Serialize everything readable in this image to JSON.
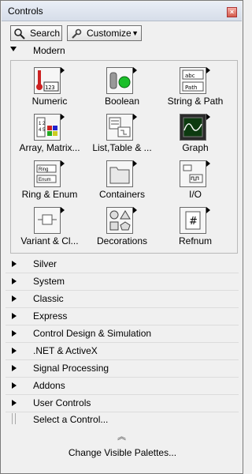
{
  "window": {
    "title": "Controls",
    "close_icon": "close-icon"
  },
  "toolbar": {
    "search_label": "Search",
    "customize_label": "Customize"
  },
  "modern": {
    "label": "Modern",
    "items": [
      {
        "label": "Numeric",
        "icon": "numeric-icon"
      },
      {
        "label": "Boolean",
        "icon": "boolean-icon"
      },
      {
        "label": "String & Path",
        "icon": "string-path-icon"
      },
      {
        "label": "Array, Matrix...",
        "icon": "array-matrix-icon"
      },
      {
        "label": "List,Table & ...",
        "icon": "list-table-icon"
      },
      {
        "label": "Graph",
        "icon": "graph-icon"
      },
      {
        "label": "Ring & Enum",
        "icon": "ring-enum-icon"
      },
      {
        "label": "Containers",
        "icon": "containers-icon"
      },
      {
        "label": "I/O",
        "icon": "io-icon"
      },
      {
        "label": "Variant & Cl...",
        "icon": "variant-class-icon"
      },
      {
        "label": "Decorations",
        "icon": "decorations-icon"
      },
      {
        "label": "Refnum",
        "icon": "refnum-icon"
      }
    ]
  },
  "palettes": [
    {
      "label": "Silver"
    },
    {
      "label": "System"
    },
    {
      "label": "Classic"
    },
    {
      "label": "Express"
    },
    {
      "label": "Control Design & Simulation"
    },
    {
      "label": ".NET & ActiveX"
    },
    {
      "label": "Signal Processing"
    },
    {
      "label": "Addons"
    },
    {
      "label": "User Controls"
    }
  ],
  "select_control": "Select a Control...",
  "change_palettes": "Change Visible Palettes..."
}
